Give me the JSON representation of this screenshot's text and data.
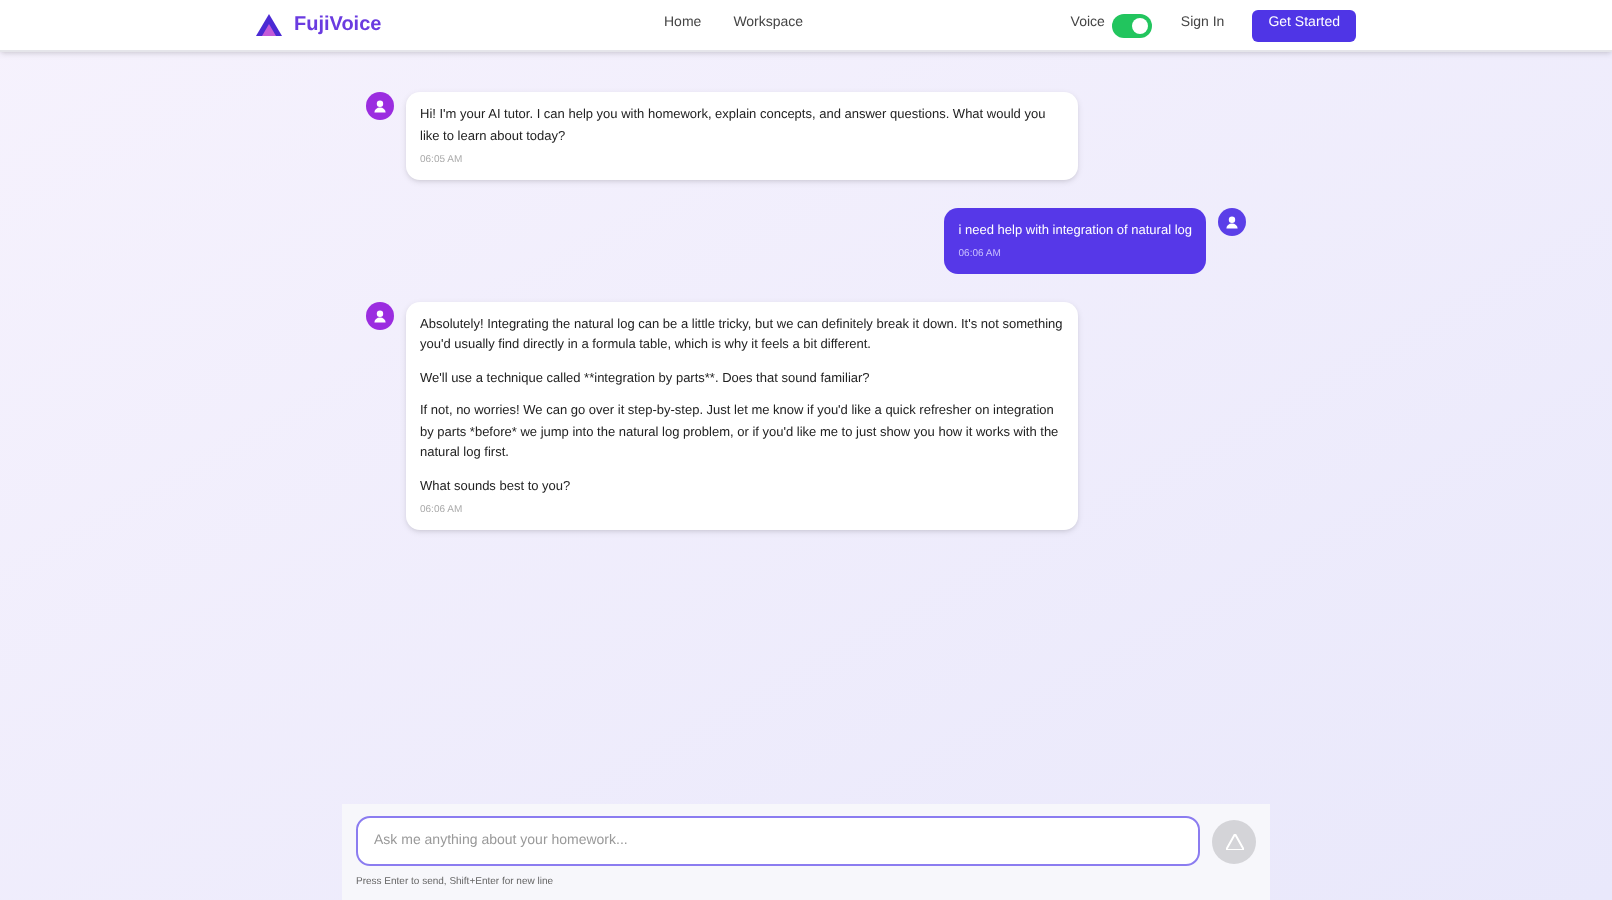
{
  "brand": "FujiVoice",
  "nav": [
    {
      "label": "Home"
    },
    {
      "label": "Workspace"
    }
  ],
  "voice": {
    "label": "Voice",
    "on": true
  },
  "sign_in": "Sign In",
  "cta": "Get Started",
  "messages": [
    {
      "kind": "assistant",
      "paragraphs": [
        "Hi! I'm your AI tutor. I can help you with homework, explain concepts, and answer questions. What would you like to learn about today?"
      ],
      "time": "06:05 AM"
    },
    {
      "kind": "user",
      "paragraphs": [
        "i need help with integration of natural log"
      ],
      "time": "06:06 AM"
    },
    {
      "kind": "assistant",
      "paragraphs": [
        "Absolutely! Integrating the natural log can be a little tricky, but we can definitely break it down. It's not something you'd usually find directly in a formula table, which is why it feels a bit different.",
        "We'll use a technique called **integration by parts**. Does that sound familiar?",
        "If not, no worries! We can go over it step-by-step. Just let me know if you'd like a quick refresher on integration by parts *before* we jump into the natural log problem, or if you'd like me to just show you how it works with the natural log first.",
        "What sounds best to you?"
      ],
      "time": "06:06 AM"
    }
  ],
  "composer": {
    "placeholder": "Ask me anything about your homework...",
    "hint": "Press Enter to send, Shift+Enter for new line",
    "send_disabled": true
  }
}
